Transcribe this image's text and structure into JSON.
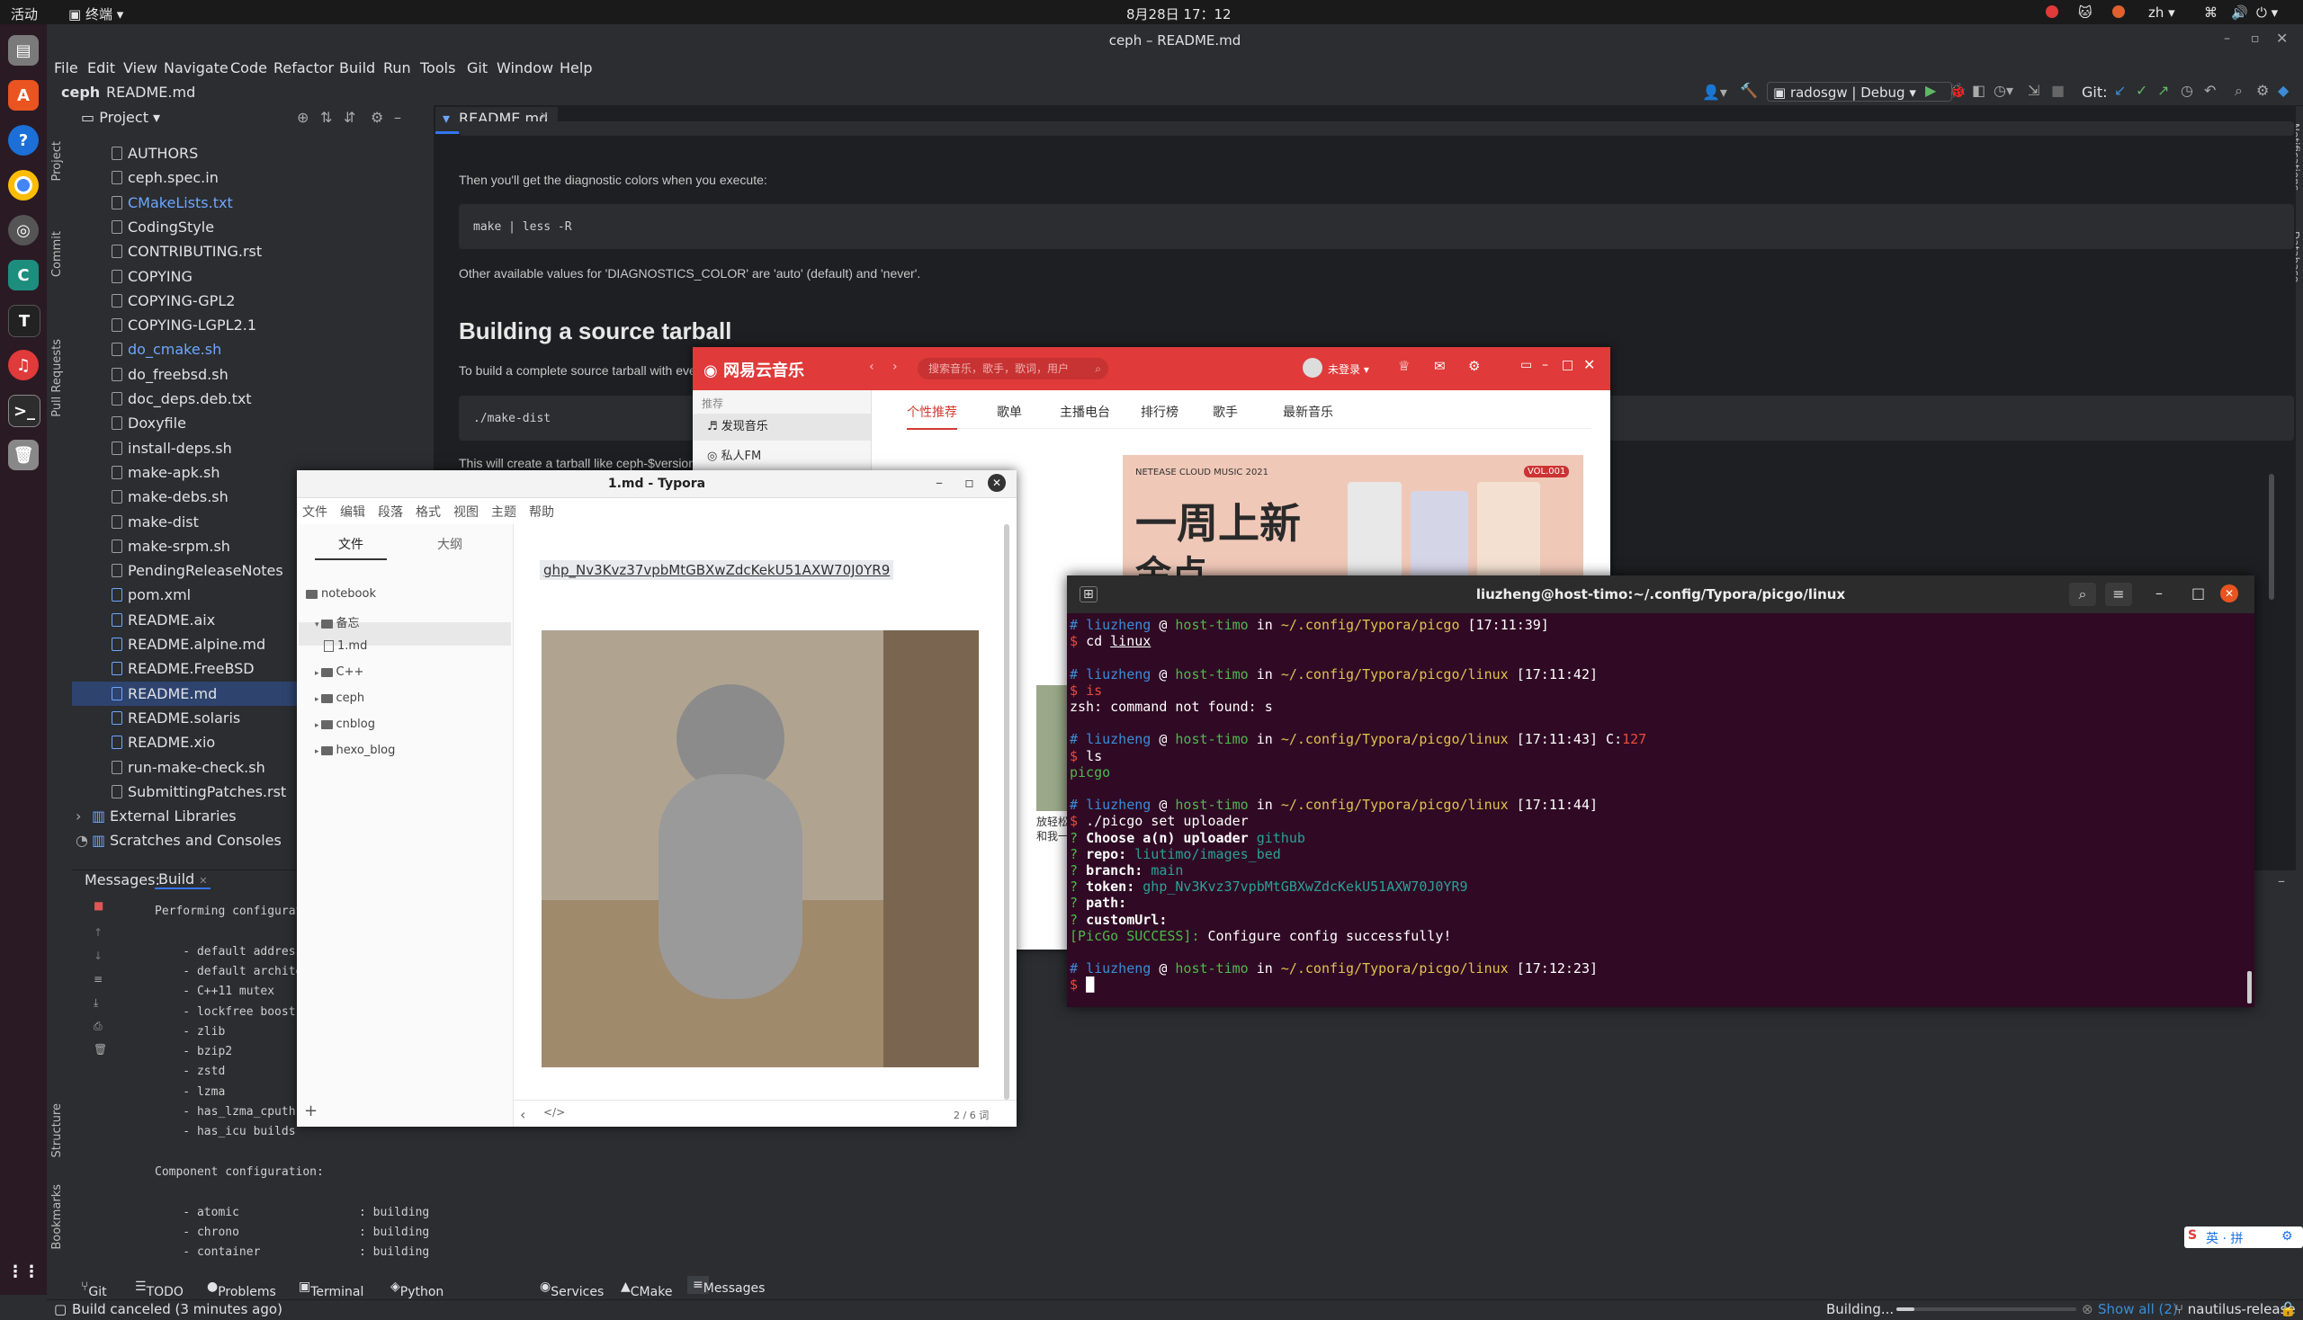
{
  "topbar": {
    "activities": "活动",
    "app": "终端",
    "clock": "8月28日  17：12",
    "lang": "zh"
  },
  "ide": {
    "title": "ceph – README.md",
    "menu": [
      "File",
      "Edit",
      "View",
      "Navigate",
      "Code",
      "Refactor",
      "Build",
      "Run",
      "Tools",
      "Git",
      "Window",
      "Help"
    ],
    "breadcrumb_project": "ceph",
    "breadcrumb_file": "README.md",
    "run_config": "radosgw | Debug",
    "git_label": "Git:",
    "project_panel_title": "Project",
    "editor_tab": "README.md",
    "tree": [
      "AUTHORS",
      "ceph.spec.in",
      "CMakeLists.txt",
      "CodingStyle",
      "CONTRIBUTING.rst",
      "COPYING",
      "COPYING-GPL2",
      "COPYING-LGPL2.1",
      "do_cmake.sh",
      "do_freebsd.sh",
      "doc_deps.deb.txt",
      "Doxyfile",
      "install-deps.sh",
      "make-apk.sh",
      "make-debs.sh",
      "make-dist",
      "make-srpm.sh",
      "PendingReleaseNotes",
      "pom.xml",
      "README.aix",
      "README.alpine.md",
      "README.FreeBSD",
      "README.md",
      "README.solaris",
      "README.xio",
      "run-make-check.sh",
      "SubmittingPatches.rst"
    ],
    "tree_extra": [
      "External Libraries",
      "Scratches and Consoles"
    ],
    "left_vtabs": [
      "Project",
      "Commit",
      "Pull Requests",
      "Structure",
      "Bookmarks"
    ],
    "right_vtabs": [
      "Notifications",
      "Database"
    ],
    "doc": {
      "p1": "Then you'll get the diagnostic colors when you execute:",
      "code1": "make | less -R",
      "p2": "Other available values for 'DIAGNOSTICS_COLOR' are 'auto' (default) and 'never'.",
      "h2": "Building a source tarball",
      "p3": "To build a complete source tarball with everything",
      "code2": "./make-dist",
      "p4": "This will create a tarball like ceph-$version.tar.bz2"
    },
    "messages_label": "Messages:",
    "build_tab": "Build",
    "build_lines": [
      "Performing configuration c",
      "",
      "    - default address-mode",
      "    - default architecture",
      "    - C++11 mutex",
      "    - lockfree boost::atom",
      "    - zlib",
      "    - bzip2",
      "    - zstd",
      "    - lzma",
      "    - has_lzma_cputhreads",
      "    - has_icu builds",
      "",
      "Component configuration:",
      "",
      "    - atomic                 : building",
      "    - chrono                 : building",
      "    - container              : building"
    ],
    "bottom_tabs": [
      "Git",
      "TODO",
      "Problems",
      "Terminal",
      "Python Packages",
      "Services",
      "CMake",
      "Messages"
    ],
    "status_left": "Build canceled (3 minutes ago)",
    "status_building": "Building...",
    "status_showall": "Show all (2)",
    "status_branch": "nautilus-release"
  },
  "netease": {
    "logo": "网易云音乐",
    "search_placeholder": "搜索音乐，歌手，歌词，用户",
    "login": "未登录",
    "sidebar_section": "推荐",
    "sidebar_items": [
      "发现音乐",
      "私人FM"
    ],
    "tabs": [
      "个性推荐",
      "歌单",
      "主播电台",
      "排行榜",
      "歌手",
      "最新音乐"
    ],
    "banner_label": "NETEASE CLOUD MUSIC 2021",
    "banner_vol": "VOL.001",
    "banner_title": "一周上新",
    "banner_sub": "金点",
    "card_text": "放轻松和我一"
  },
  "typora": {
    "title": "1.md - Typora",
    "menu": [
      "文件",
      "编辑",
      "段落",
      "格式",
      "视图",
      "主题",
      "帮助"
    ],
    "side_tabs": [
      "文件",
      "大纲"
    ],
    "tree": [
      {
        "name": "notebook",
        "indent": 0,
        "kind": "folder"
      },
      {
        "name": "备忘",
        "indent": 1,
        "kind": "folder-open"
      },
      {
        "name": "1.md",
        "indent": 2,
        "kind": "file"
      },
      {
        "name": "C++",
        "indent": 1,
        "kind": "folder"
      },
      {
        "name": "ceph",
        "indent": 1,
        "kind": "folder"
      },
      {
        "name": "cnblog",
        "indent": 1,
        "kind": "folder"
      },
      {
        "name": "hexo_blog",
        "indent": 1,
        "kind": "folder"
      }
    ],
    "token_text": "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",
    "word_count": "2 / 6 词"
  },
  "terminal": {
    "title": "liuzheng@host-timo:~/.config/Typora/picgo/linux",
    "lines": [
      [
        {
          "t": "# ",
          "c": "c-blue"
        },
        {
          "t": "liuzheng",
          "c": "c-user"
        },
        {
          "t": " @ ",
          "c": ""
        },
        {
          "t": "host-timo",
          "c": "c-green"
        },
        {
          "t": " in ",
          "c": ""
        },
        {
          "t": "~/.config/Typora/picgo",
          "c": "c-yellow"
        },
        {
          "t": " [17:11:39]",
          "c": ""
        }
      ],
      [
        {
          "t": "$ ",
          "c": "c-red"
        },
        {
          "t": "cd ",
          "c": ""
        },
        {
          "t": "linux",
          "c": "u"
        }
      ],
      [],
      [
        {
          "t": "# ",
          "c": "c-blue"
        },
        {
          "t": "liuzheng",
          "c": "c-user"
        },
        {
          "t": " @ ",
          "c": ""
        },
        {
          "t": "host-timo",
          "c": "c-green"
        },
        {
          "t": " in ",
          "c": ""
        },
        {
          "t": "~/.config/Typora/picgo/linux",
          "c": "c-yellow"
        },
        {
          "t": " [17:11:42]",
          "c": ""
        }
      ],
      [
        {
          "t": "$ ",
          "c": "c-red"
        },
        {
          "t": "is",
          "c": "c-red"
        }
      ],
      [
        {
          "t": "zsh: command not found: s",
          "c": ""
        }
      ],
      [],
      [
        {
          "t": "# ",
          "c": "c-blue"
        },
        {
          "t": "liuzheng",
          "c": "c-user"
        },
        {
          "t": " @ ",
          "c": ""
        },
        {
          "t": "host-timo",
          "c": "c-green"
        },
        {
          "t": " in ",
          "c": ""
        },
        {
          "t": "~/.config/Typora/picgo/linux",
          "c": "c-yellow"
        },
        {
          "t": " [17:11:43] C:",
          "c": ""
        },
        {
          "t": "127",
          "c": "c-red"
        }
      ],
      [
        {
          "t": "$ ",
          "c": "c-red"
        },
        {
          "t": "ls",
          "c": ""
        }
      ],
      [
        {
          "t": "picgo",
          "c": "c-green"
        }
      ],
      [],
      [
        {
          "t": "# ",
          "c": "c-blue"
        },
        {
          "t": "liuzheng",
          "c": "c-user"
        },
        {
          "t": " @ ",
          "c": ""
        },
        {
          "t": "host-timo",
          "c": "c-green"
        },
        {
          "t": " in ",
          "c": ""
        },
        {
          "t": "~/.config/Typora/picgo/linux",
          "c": "c-yellow"
        },
        {
          "t": " [17:11:44]",
          "c": ""
        }
      ],
      [
        {
          "t": "$ ",
          "c": "c-red"
        },
        {
          "t": "./picgo set uploader",
          "c": ""
        }
      ],
      [
        {
          "t": "? ",
          "c": "c-green"
        },
        {
          "t": "Choose a(n) uploader ",
          "c": "b"
        },
        {
          "t": "github",
          "c": "c-teal"
        }
      ],
      [
        {
          "t": "? ",
          "c": "c-green"
        },
        {
          "t": "repo: ",
          "c": "b"
        },
        {
          "t": "liutimo/images_bed",
          "c": "c-teal"
        }
      ],
      [
        {
          "t": "? ",
          "c": "c-green"
        },
        {
          "t": "branch: ",
          "c": "b"
        },
        {
          "t": "main",
          "c": "c-teal"
        }
      ],
      [
        {
          "t": "? ",
          "c": "c-green"
        },
        {
          "t": "token: ",
          "c": "b"
        },
        {
          "t": "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",
          "c": "c-teal"
        }
      ],
      [
        {
          "t": "? ",
          "c": "c-green"
        },
        {
          "t": "path:",
          "c": "b"
        }
      ],
      [
        {
          "t": "? ",
          "c": "c-green"
        },
        {
          "t": "customUrl:",
          "c": "b"
        }
      ],
      [
        {
          "t": "[PicGo SUCCESS]: ",
          "c": "c-green"
        },
        {
          "t": "Configure config successfully!",
          "c": ""
        }
      ],
      [],
      [
        {
          "t": "# ",
          "c": "c-blue"
        },
        {
          "t": "liuzheng",
          "c": "c-user"
        },
        {
          "t": " @ ",
          "c": ""
        },
        {
          "t": "host-timo",
          "c": "c-green"
        },
        {
          "t": " in ",
          "c": ""
        },
        {
          "t": "~/.config/Typora/picgo/linux",
          "c": "c-yellow"
        },
        {
          "t": " [17:12:23]",
          "c": ""
        }
      ],
      [
        {
          "t": "$ ",
          "c": "c-red"
        },
        {
          "t": "█",
          "c": "cur"
        }
      ]
    ]
  },
  "ime": {
    "label": "英 · 拼"
  }
}
